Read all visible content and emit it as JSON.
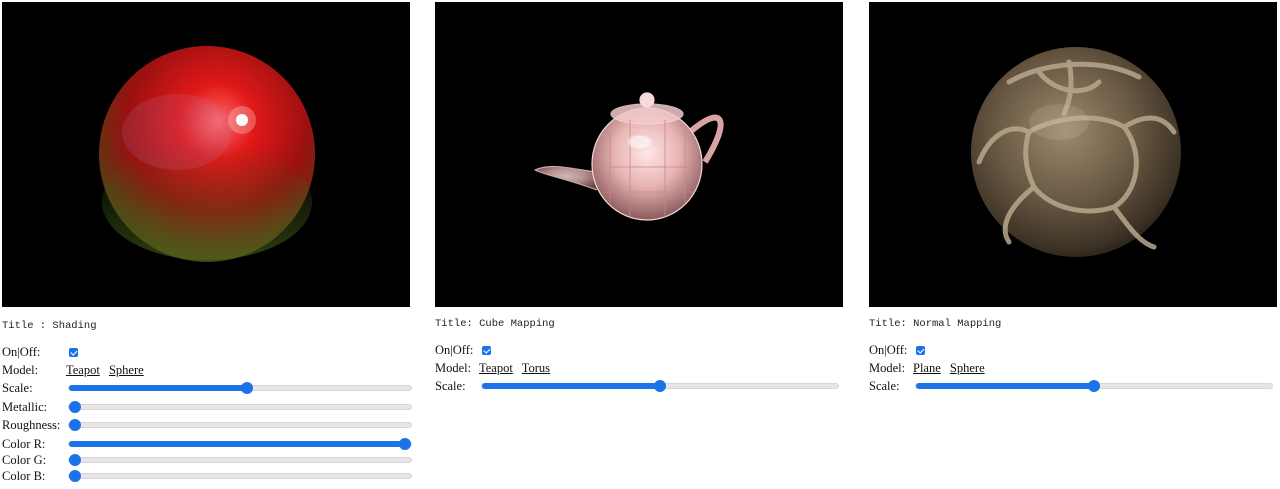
{
  "panels": [
    {
      "title": "Title : Shading",
      "onoff_label": "On|Off:",
      "onoff_checked": true,
      "model_label": "Model:",
      "models": [
        "Teapot",
        "Sphere"
      ],
      "sliders": [
        {
          "label": "Scale:",
          "value": 0.52
        },
        {
          "label": "Metallic:",
          "value": 0.0
        },
        {
          "label": "Roughness:",
          "value": 0.0
        },
        {
          "label": "Color R:",
          "value": 1.0
        },
        {
          "label": "Color G:",
          "value": 0.0
        },
        {
          "label": "Color B:",
          "value": 0.0
        }
      ]
    },
    {
      "title": "Title: Cube Mapping",
      "onoff_label": "On|Off:",
      "onoff_checked": true,
      "model_label": "Model:",
      "models": [
        "Teapot",
        "Torus"
      ],
      "sliders": [
        {
          "label": "Scale:",
          "value": 0.5
        }
      ]
    },
    {
      "title": "Title: Normal Mapping",
      "onoff_label": "On|Off:",
      "onoff_checked": true,
      "model_label": "Model:",
      "models": [
        "Plane",
        "Sphere"
      ],
      "sliders": [
        {
          "label": "Scale:",
          "value": 0.5
        }
      ]
    }
  ],
  "colors": {
    "accent": "#1a73e8",
    "canvas_bg": "#000000",
    "track": "#e6e6e6"
  }
}
